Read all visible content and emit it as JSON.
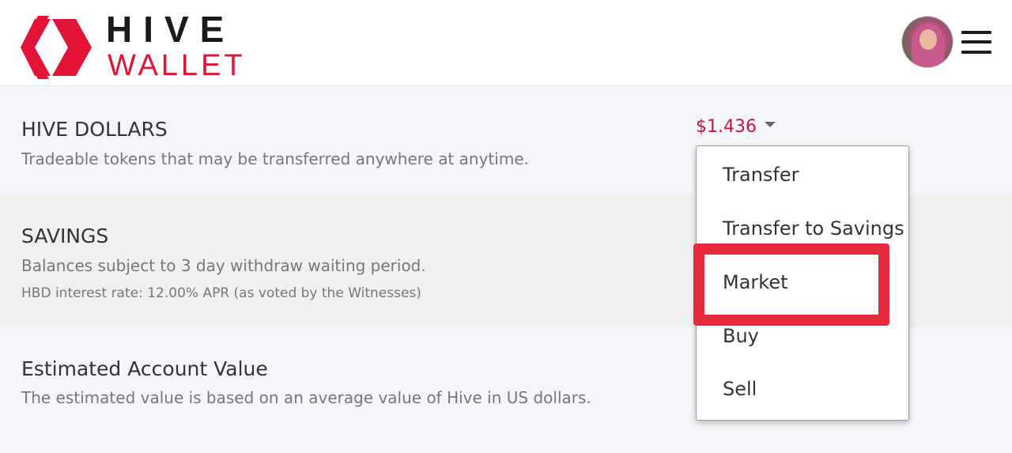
{
  "header": {
    "logo_top": "HIVE",
    "logo_bottom": "WALLET",
    "brand_color": "#e31337",
    "avatar_icon": "user-avatar",
    "menu_icon": "hamburger-menu-icon"
  },
  "hbd": {
    "title": "HIVE DOLLARS",
    "description": "Tradeable tokens that may be transferred anywhere at anytime.",
    "balance": "$1.436"
  },
  "savings": {
    "title": "SAVINGS",
    "description": "Balances subject to 3 day withdraw waiting period.",
    "interest": "HBD interest rate: 12.00% APR (as voted by the Witnesses)"
  },
  "estimate": {
    "title": "Estimated Account Value",
    "description": "The estimated value is based on an average value of Hive in US dollars."
  },
  "dropdown": {
    "items": [
      {
        "label": "Transfer"
      },
      {
        "label": "Transfer to Savings"
      },
      {
        "label": "Market"
      },
      {
        "label": "Buy"
      },
      {
        "label": "Sell"
      }
    ],
    "highlighted": "Market",
    "highlight_color": "#e8283d"
  }
}
